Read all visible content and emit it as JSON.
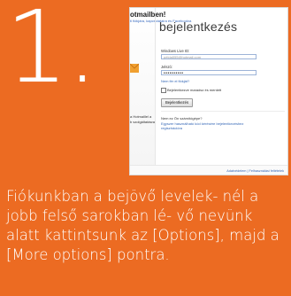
{
  "step": {
    "number": "1."
  },
  "screenshot": {
    "left_panel": {
      "brand_fragment": "otmailben!",
      "brand_sub": "ti fiókjára, kapcsolataira és Facebookra",
      "lines": [
        "a Hotmaillel a",
        "b szolgáltatásra"
      ]
    },
    "main": {
      "title": "bejelentkezés",
      "email_label": "Windows Live ID:",
      "email_placeholder": "példa555@hotmail.com",
      "password_label": "Jelszó:",
      "password_value": "••••••••••",
      "forgot_link": "Nem fér el fiókját?",
      "remember_label": "Bejelentkezve maradsz és mentett",
      "login_button": "Bejelentkezés",
      "question": "Nem ez Ön számítógépe?",
      "signup_link1": "Egyszer használható kód kérésére bejelentkezéshez",
      "signup_link2": "regisztrációra",
      "footer": "Adatvédelem | Felhasználási feltételek"
    }
  },
  "caption": "Fiókunkban a bejövő levelek- nél a jobb felső sarokban lé- vő nevünk alatt kattintsunk az [Options], majd a [More options] pontra."
}
